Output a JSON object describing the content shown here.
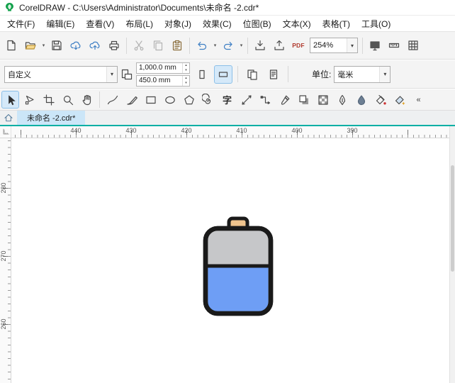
{
  "window": {
    "title": "CorelDRAW - C:\\Users\\Administrator\\Documents\\未命名 -2.cdr*"
  },
  "menu_bar": {
    "items": [
      {
        "name": "menu-file",
        "label": "文件(F)"
      },
      {
        "name": "menu-edit",
        "label": "编辑(E)"
      },
      {
        "name": "menu-view",
        "label": "查看(V)"
      },
      {
        "name": "menu-layout",
        "label": "布局(L)"
      },
      {
        "name": "menu-object",
        "label": "对象(J)"
      },
      {
        "name": "menu-effects",
        "label": "效果(C)"
      },
      {
        "name": "menu-bitmaps",
        "label": "位图(B)"
      },
      {
        "name": "menu-text",
        "label": "文本(X)"
      },
      {
        "name": "menu-table",
        "label": "表格(T)"
      },
      {
        "name": "menu-tools",
        "label": "工具(O)"
      }
    ]
  },
  "standard_toolbar": {
    "controls": [
      {
        "type": "button",
        "name": "new-document-button",
        "icon": "new-document"
      },
      {
        "type": "button",
        "name": "open-button",
        "icon": "open-folder",
        "dropdown": true
      },
      {
        "type": "button",
        "name": "save-button",
        "icon": "save"
      },
      {
        "type": "button",
        "name": "open-from-cloud-button",
        "icon": "cloud-download"
      },
      {
        "type": "button",
        "name": "save-to-cloud-button",
        "icon": "cloud-upload"
      },
      {
        "type": "button",
        "name": "print-button",
        "icon": "print"
      },
      {
        "type": "separator"
      },
      {
        "type": "button",
        "name": "cut-button",
        "icon": "cut",
        "disabled": true
      },
      {
        "type": "button",
        "name": "copy-button",
        "icon": "copy",
        "disabled": true
      },
      {
        "type": "button",
        "name": "paste-button",
        "icon": "paste"
      },
      {
        "type": "separator"
      },
      {
        "type": "button",
        "name": "undo-button",
        "icon": "undo",
        "dropdown": true
      },
      {
        "type": "button",
        "name": "redo-button",
        "icon": "redo",
        "dropdown": true
      },
      {
        "type": "separator"
      },
      {
        "type": "button",
        "name": "import-button",
        "icon": "import"
      },
      {
        "type": "button",
        "name": "export-button",
        "icon": "export"
      },
      {
        "type": "button",
        "name": "publish-pdf-button",
        "label": "PDF"
      },
      {
        "type": "combo",
        "name": "zoom-level-combobox",
        "value": "254%"
      },
      {
        "type": "separator"
      },
      {
        "type": "button",
        "name": "fullscreen-preview-button",
        "icon": "fullscreen"
      },
      {
        "type": "button",
        "name": "show-rulers-button",
        "icon": "show-rulers"
      },
      {
        "type": "button",
        "name": "show-grid-button",
        "icon": "show-grid"
      }
    ]
  },
  "property_bar": {
    "preset_value": "自定义",
    "page_width": "1,000.0 mm",
    "page_height": "450.0 mm",
    "units_label": "单位:",
    "units_value": "毫米"
  },
  "toolbox": {
    "tools": [
      {
        "name": "pick-tool",
        "icon": "pick",
        "active": true
      },
      {
        "name": "shape-tool",
        "icon": "shape"
      },
      {
        "name": "crop-tool",
        "icon": "crop"
      },
      {
        "name": "zoom-tool",
        "icon": "zoom"
      },
      {
        "name": "pan-tool",
        "icon": "pan"
      },
      {
        "separator": true
      },
      {
        "name": "freehand-tool",
        "icon": "freehand"
      },
      {
        "name": "artistic-media-tool",
        "icon": "artistic-media"
      },
      {
        "name": "rectangle-tool",
        "icon": "rectangle"
      },
      {
        "name": "ellipse-tool",
        "icon": "ellipse"
      },
      {
        "name": "polygon-tool",
        "icon": "polygon"
      },
      {
        "name": "spiral-tool",
        "icon": "spiral"
      },
      {
        "name": "text-tool",
        "label": "字"
      },
      {
        "name": "dimension-tool",
        "icon": "dimension"
      },
      {
        "name": "connector-tool",
        "icon": "connector"
      },
      {
        "name": "eyedropper-tool",
        "icon": "eyedropper"
      },
      {
        "name": "drop-shadow-tool",
        "icon": "drop-shadow"
      },
      {
        "name": "transparency-tool",
        "icon": "transparency"
      },
      {
        "name": "outline-pen-tool",
        "icon": "outline-pen"
      },
      {
        "name": "edit-fill-tool",
        "icon": "edit-fill"
      },
      {
        "name": "interactive-fill-tool",
        "icon": "interactive-fill"
      },
      {
        "name": "smart-fill-tool",
        "icon": "smart-fill"
      },
      {
        "name": "toolbox-overflow-button",
        "label": "«",
        "overflow": true
      }
    ]
  },
  "document_tabs": {
    "tabs": [
      {
        "label": "未命名 -2.cdr*",
        "active": true
      }
    ]
  },
  "rulers": {
    "horizontal_labels": [
      "440",
      "430",
      "420",
      "410",
      "400",
      "390"
    ],
    "vertical_labels": [
      "280",
      "270",
      "260"
    ]
  },
  "canvas": {
    "battery": {
      "cap_fill": "#F0C48E",
      "body_top_fill": "#C6C7C9",
      "body_bottom_fill": "#6E9EF5",
      "outline": "#1A1A1A"
    }
  },
  "colors": {
    "accent_teal": "#00AFA4",
    "tab_active_bg": "#CBE6F8",
    "active_tool_bg": "#D5E9F9"
  }
}
